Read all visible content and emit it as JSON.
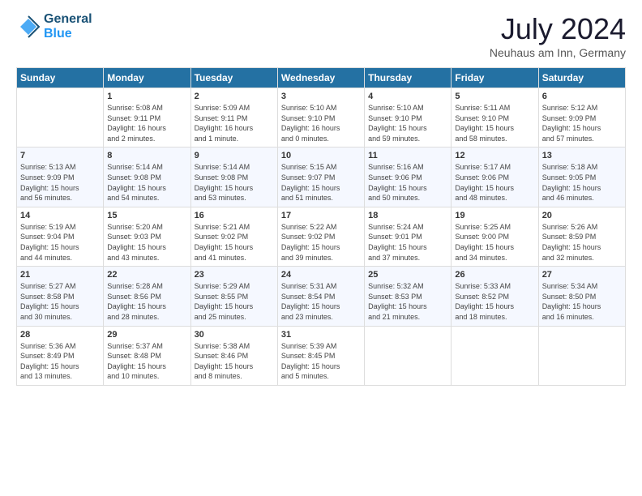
{
  "header": {
    "logo_line1": "General",
    "logo_line2": "Blue",
    "month": "July 2024",
    "location": "Neuhaus am Inn, Germany"
  },
  "weekdays": [
    "Sunday",
    "Monday",
    "Tuesday",
    "Wednesday",
    "Thursday",
    "Friday",
    "Saturday"
  ],
  "weeks": [
    [
      {
        "day": "",
        "info": ""
      },
      {
        "day": "1",
        "info": "Sunrise: 5:08 AM\nSunset: 9:11 PM\nDaylight: 16 hours\nand 2 minutes."
      },
      {
        "day": "2",
        "info": "Sunrise: 5:09 AM\nSunset: 9:11 PM\nDaylight: 16 hours\nand 1 minute."
      },
      {
        "day": "3",
        "info": "Sunrise: 5:10 AM\nSunset: 9:10 PM\nDaylight: 16 hours\nand 0 minutes."
      },
      {
        "day": "4",
        "info": "Sunrise: 5:10 AM\nSunset: 9:10 PM\nDaylight: 15 hours\nand 59 minutes."
      },
      {
        "day": "5",
        "info": "Sunrise: 5:11 AM\nSunset: 9:10 PM\nDaylight: 15 hours\nand 58 minutes."
      },
      {
        "day": "6",
        "info": "Sunrise: 5:12 AM\nSunset: 9:09 PM\nDaylight: 15 hours\nand 57 minutes."
      }
    ],
    [
      {
        "day": "7",
        "info": "Sunrise: 5:13 AM\nSunset: 9:09 PM\nDaylight: 15 hours\nand 56 minutes."
      },
      {
        "day": "8",
        "info": "Sunrise: 5:14 AM\nSunset: 9:08 PM\nDaylight: 15 hours\nand 54 minutes."
      },
      {
        "day": "9",
        "info": "Sunrise: 5:14 AM\nSunset: 9:08 PM\nDaylight: 15 hours\nand 53 minutes."
      },
      {
        "day": "10",
        "info": "Sunrise: 5:15 AM\nSunset: 9:07 PM\nDaylight: 15 hours\nand 51 minutes."
      },
      {
        "day": "11",
        "info": "Sunrise: 5:16 AM\nSunset: 9:06 PM\nDaylight: 15 hours\nand 50 minutes."
      },
      {
        "day": "12",
        "info": "Sunrise: 5:17 AM\nSunset: 9:06 PM\nDaylight: 15 hours\nand 48 minutes."
      },
      {
        "day": "13",
        "info": "Sunrise: 5:18 AM\nSunset: 9:05 PM\nDaylight: 15 hours\nand 46 minutes."
      }
    ],
    [
      {
        "day": "14",
        "info": "Sunrise: 5:19 AM\nSunset: 9:04 PM\nDaylight: 15 hours\nand 44 minutes."
      },
      {
        "day": "15",
        "info": "Sunrise: 5:20 AM\nSunset: 9:03 PM\nDaylight: 15 hours\nand 43 minutes."
      },
      {
        "day": "16",
        "info": "Sunrise: 5:21 AM\nSunset: 9:02 PM\nDaylight: 15 hours\nand 41 minutes."
      },
      {
        "day": "17",
        "info": "Sunrise: 5:22 AM\nSunset: 9:02 PM\nDaylight: 15 hours\nand 39 minutes."
      },
      {
        "day": "18",
        "info": "Sunrise: 5:24 AM\nSunset: 9:01 PM\nDaylight: 15 hours\nand 37 minutes."
      },
      {
        "day": "19",
        "info": "Sunrise: 5:25 AM\nSunset: 9:00 PM\nDaylight: 15 hours\nand 34 minutes."
      },
      {
        "day": "20",
        "info": "Sunrise: 5:26 AM\nSunset: 8:59 PM\nDaylight: 15 hours\nand 32 minutes."
      }
    ],
    [
      {
        "day": "21",
        "info": "Sunrise: 5:27 AM\nSunset: 8:58 PM\nDaylight: 15 hours\nand 30 minutes."
      },
      {
        "day": "22",
        "info": "Sunrise: 5:28 AM\nSunset: 8:56 PM\nDaylight: 15 hours\nand 28 minutes."
      },
      {
        "day": "23",
        "info": "Sunrise: 5:29 AM\nSunset: 8:55 PM\nDaylight: 15 hours\nand 25 minutes."
      },
      {
        "day": "24",
        "info": "Sunrise: 5:31 AM\nSunset: 8:54 PM\nDaylight: 15 hours\nand 23 minutes."
      },
      {
        "day": "25",
        "info": "Sunrise: 5:32 AM\nSunset: 8:53 PM\nDaylight: 15 hours\nand 21 minutes."
      },
      {
        "day": "26",
        "info": "Sunrise: 5:33 AM\nSunset: 8:52 PM\nDaylight: 15 hours\nand 18 minutes."
      },
      {
        "day": "27",
        "info": "Sunrise: 5:34 AM\nSunset: 8:50 PM\nDaylight: 15 hours\nand 16 minutes."
      }
    ],
    [
      {
        "day": "28",
        "info": "Sunrise: 5:36 AM\nSunset: 8:49 PM\nDaylight: 15 hours\nand 13 minutes."
      },
      {
        "day": "29",
        "info": "Sunrise: 5:37 AM\nSunset: 8:48 PM\nDaylight: 15 hours\nand 10 minutes."
      },
      {
        "day": "30",
        "info": "Sunrise: 5:38 AM\nSunset: 8:46 PM\nDaylight: 15 hours\nand 8 minutes."
      },
      {
        "day": "31",
        "info": "Sunrise: 5:39 AM\nSunset: 8:45 PM\nDaylight: 15 hours\nand 5 minutes."
      },
      {
        "day": "",
        "info": ""
      },
      {
        "day": "",
        "info": ""
      },
      {
        "day": "",
        "info": ""
      }
    ]
  ]
}
